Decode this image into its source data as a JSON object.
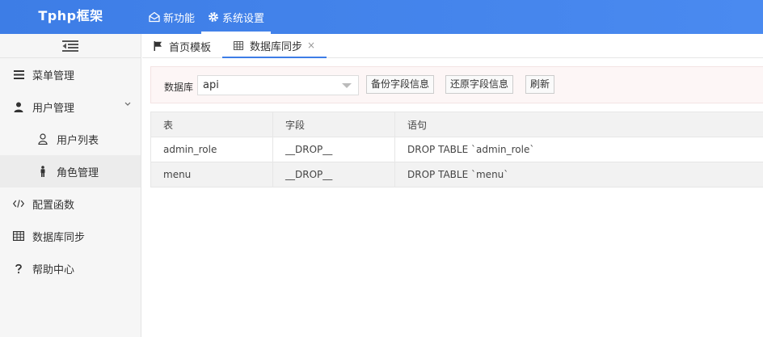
{
  "header": {
    "brand": "Tphp框架",
    "nav": [
      {
        "label": "新功能",
        "icon": "mail-open-icon"
      },
      {
        "label": "系统设置",
        "icon": "gear-icon",
        "active": true
      }
    ]
  },
  "sidebar": {
    "items": [
      {
        "label": "菜单管理",
        "icon": "menu-lines-icon"
      },
      {
        "label": "用户管理",
        "icon": "user-icon",
        "expanded": true
      },
      {
        "label": "用户列表",
        "icon": "user-outline-icon",
        "sub": true
      },
      {
        "label": "角色管理",
        "icon": "person-standing-icon",
        "sub": true,
        "active": true
      },
      {
        "label": "配置函数",
        "icon": "code-icon"
      },
      {
        "label": "数据库同步",
        "icon": "table-icon"
      },
      {
        "label": "帮助中心",
        "icon": "question-icon"
      }
    ]
  },
  "tabs": [
    {
      "label": "首页模板",
      "icon": "flag-icon"
    },
    {
      "label": "数据库同步",
      "icon": "table-icon",
      "active": true,
      "close": "×"
    }
  ],
  "form": {
    "db_label": "数据库",
    "db_value": "api",
    "buttons": [
      "备份字段信息",
      "还原字段信息",
      "刷新"
    ]
  },
  "table": {
    "headers": [
      "表",
      "字段",
      "语句"
    ],
    "rows": [
      [
        "admin_role",
        "__DROP__",
        "DROP TABLE `admin_role`"
      ],
      [
        "menu",
        "__DROP__",
        "DROP TABLE `menu`"
      ]
    ]
  },
  "colors": {
    "header_bg": "#3d7de6",
    "tab_active": "#3d7de6",
    "form_bg": "#fdf6f6"
  }
}
